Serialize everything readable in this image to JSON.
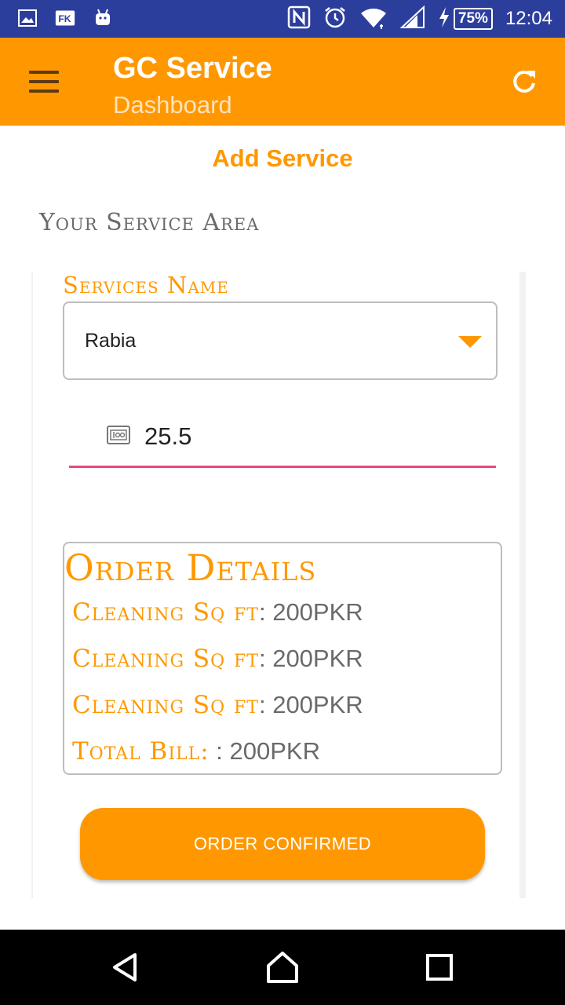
{
  "status_bar": {
    "time": "12:04",
    "battery": "75%",
    "left_icons": [
      "gallery-icon",
      "app-fk-icon",
      "android-icon"
    ],
    "right_icons": [
      "nfc-icon",
      "alarm-icon",
      "wifi-icon",
      "signal-icon",
      "charging-icon"
    ],
    "fk_label": "FK"
  },
  "app_bar": {
    "title": "GC Service",
    "subtitle": "Dashboard",
    "color": "#ff9800"
  },
  "page": {
    "heading": "Add Service",
    "section_label": "Your Service Area"
  },
  "form": {
    "service_label": "Services Name",
    "service_value": "Rabia",
    "amount_value": "25.5",
    "amount_icon": "meter-icon"
  },
  "order_details": {
    "title": "Order Details",
    "lines": [
      {
        "label": "Cleaning Sq ft",
        "sep": ": ",
        "value": "200PKR"
      },
      {
        "label": "Cleaning Sq ft",
        "sep": ": ",
        "value": "200PKR"
      },
      {
        "label": "Cleaning Sq ft",
        "sep": ": ",
        "value": "200PKR"
      },
      {
        "label": "Total Bill:",
        "sep": " : ",
        "value": "200PKR"
      }
    ]
  },
  "confirm_button": "ORDER CONFIRMED",
  "nav_bar": {
    "icons": [
      "back-icon",
      "home-icon",
      "recents-icon"
    ]
  }
}
